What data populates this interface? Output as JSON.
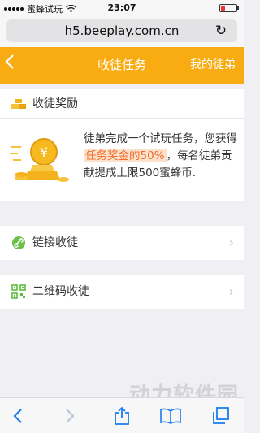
{
  "status": {
    "carrier": "蜜蜂试玩",
    "time": "23:07"
  },
  "browser": {
    "url": "h5.beeplay.com.cn"
  },
  "nav": {
    "title": "收徒任务",
    "right_link": "我的徒弟"
  },
  "reward": {
    "heading": "收徒奖励",
    "text_before": "徒弟完成一个试玩任务，您获得",
    "highlight": "任务奖金的50%",
    "text_after": "，每名徒弟贡献提成上限500蜜蜂币."
  },
  "options": [
    {
      "label": "链接收徒",
      "icon": "link-icon"
    },
    {
      "label": "二维码收徒",
      "icon": "qrcode-icon"
    }
  ],
  "watermark": "动力软件园",
  "colors": {
    "accent": "#f9ac12",
    "highlight_bg": "#fde2cb",
    "highlight_text": "#ee6b2c",
    "toolbar_blue": "#1a7cf0"
  }
}
